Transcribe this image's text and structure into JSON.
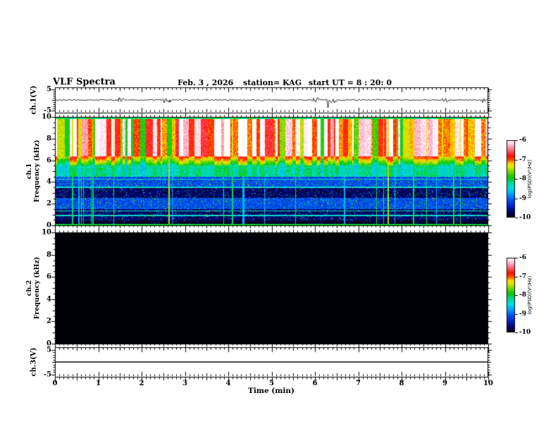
{
  "header": {
    "title": "VLF Spectra",
    "date": "Feb. 3 , 2026",
    "station": "station= KAG",
    "start_ut": "start UT =  8 : 20: 0"
  },
  "time_axis": {
    "label": "Time (min)",
    "range": [
      0,
      10
    ],
    "ticks": [
      0,
      1,
      2,
      3,
      4,
      5,
      6,
      7,
      8,
      9,
      10
    ],
    "minor_tick_step": 0.1
  },
  "panels": {
    "ch1_voltage": {
      "ylabel": "ch.1(V)",
      "yticks": [
        5,
        -5
      ],
      "ylim": [
        -6,
        6
      ]
    },
    "ch1_spectrogram": {
      "ylabel_line1": "ch.1",
      "ylabel_line2": "Frequency (kHz)",
      "yticks": [
        0,
        2,
        4,
        6,
        8,
        10
      ],
      "ylim": [
        0,
        10
      ]
    },
    "ch2_spectrogram": {
      "ylabel_line1": "ch.2",
      "ylabel_line2": "Frequency (kHz)",
      "yticks": [
        0,
        2,
        4,
        6,
        8,
        10
      ],
      "ylim": [
        0,
        10
      ]
    },
    "ch3_voltage": {
      "ylabel": "ch.3(V)",
      "yticks": [
        5,
        -5
      ],
      "ylim": [
        -6,
        6
      ]
    }
  },
  "colorbar": {
    "label": "log(PSD)(V²/Hz)",
    "ticks": [
      -6,
      -7,
      -8,
      -9,
      -10
    ],
    "range": [
      -10,
      -6
    ],
    "stops": [
      [
        0.0,
        "#000006"
      ],
      [
        0.05,
        "#000050"
      ],
      [
        0.12,
        "#0014b4"
      ],
      [
        0.22,
        "#0050f0"
      ],
      [
        0.3,
        "#009cff"
      ],
      [
        0.38,
        "#00e0e8"
      ],
      [
        0.45,
        "#00d88c"
      ],
      [
        0.52,
        "#0ac800"
      ],
      [
        0.6,
        "#7cdc00"
      ],
      [
        0.66,
        "#e6e800"
      ],
      [
        0.7,
        "#ffd200"
      ],
      [
        0.75,
        "#ff4600"
      ],
      [
        0.8,
        "#ff0f00"
      ],
      [
        0.87,
        "#ff647e"
      ],
      [
        0.94,
        "#ffbed2"
      ],
      [
        1.0,
        "#ffffff"
      ]
    ]
  },
  "chart_data": [
    {
      "panel": "ch1-voltage",
      "type": "line",
      "x_range_min": [
        0,
        10
      ],
      "ylim": [
        -6,
        6
      ],
      "baseline_v": 0,
      "noise_amp_v": 0.3,
      "spikes": [
        {
          "t_min": 6.3,
          "v": -3.5
        }
      ],
      "description": "broadband noise trace centred on 0 V with a brief downward spike to about -3.5 V near t = 6.3 min"
    },
    {
      "panel": "ch1-spectrogram",
      "type": "heatmap",
      "x_range_min": [
        0,
        10
      ],
      "f_range_khz": [
        0,
        10
      ],
      "psd_range": [
        -10,
        -6
      ],
      "bands": [
        {
          "f": [
            9.78,
            10.0
          ],
          "psd": -8.1,
          "jitter": 0.9,
          "desc": "green-cyan upper rim"
        },
        {
          "f": [
            6.35,
            9.78
          ],
          "psd": -6.95,
          "jitter": 0.4,
          "striation": 1.15,
          "desc": "intense red emission with white vertical patches and green column gaps"
        },
        {
          "f": [
            5.55,
            6.35
          ],
          "psd_top": -7.15,
          "psd_bottom": -8.15,
          "jitter": 0.45,
          "desc": "red-to-green transition"
        },
        {
          "f": [
            4.5,
            5.55
          ],
          "psd": -8.35,
          "jitter": 0.6,
          "desc": "green band"
        },
        {
          "f": [
            0.45,
            4.5
          ],
          "psd": -9.15,
          "jitter": 0.55,
          "desc": "blue field with speckles and dark horizontal bands"
        },
        {
          "f": [
            0.0,
            0.45
          ],
          "psd": -9.9,
          "jitter": 0.25,
          "desc": "near-black base"
        }
      ],
      "dark_bands_f": [
        [
          2.5,
          3.45
        ],
        [
          0.4,
          1.5
        ]
      ],
      "bright_rows_f": [
        4.25,
        3.5,
        1.35,
        0.92
      ],
      "speckle_probability": 0.055,
      "vertical_line_count": 26,
      "edge_line_psd": -8.0
    },
    {
      "panel": "ch2-spectrogram",
      "type": "heatmap",
      "x_range_min": [
        0,
        10
      ],
      "f_range_khz": [
        0,
        10
      ],
      "psd_range": [
        -10,
        -6
      ],
      "uniform_psd": -10,
      "description": "no signal — uniform black panel"
    },
    {
      "panel": "ch3-voltage",
      "type": "line",
      "x_range_min": [
        0,
        10
      ],
      "ylim": [
        -6,
        6
      ],
      "baseline_v": 0,
      "noise_amp_v": 0,
      "spikes": [],
      "description": "flat trace at 0 V"
    }
  ]
}
